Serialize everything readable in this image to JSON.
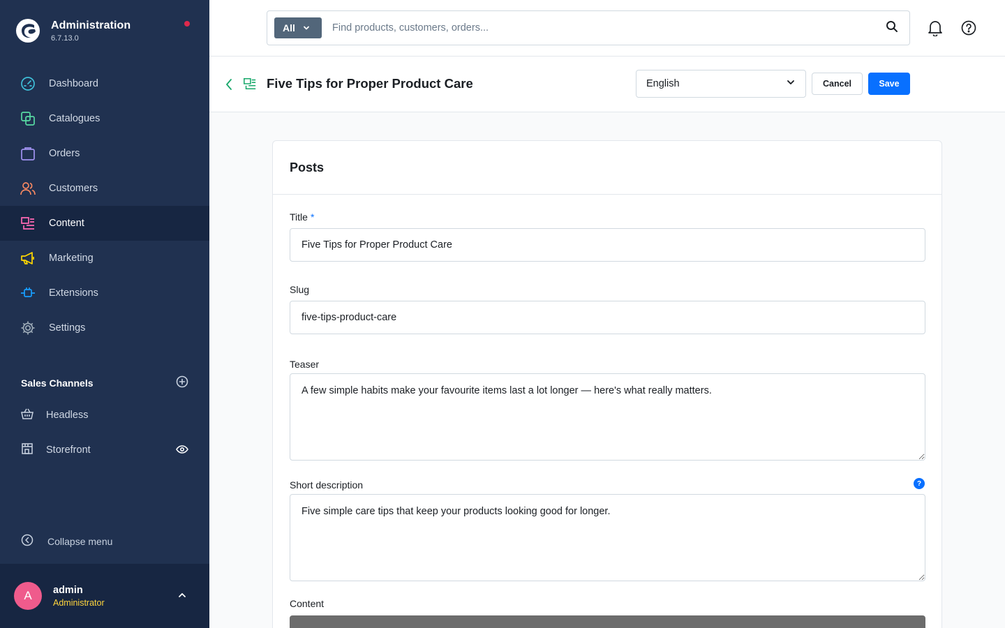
{
  "app": {
    "title": "Administration",
    "version": "6.7.13.0"
  },
  "sidebar": {
    "items": [
      {
        "label": "Dashboard",
        "icon": "dashboard-gauge-icon"
      },
      {
        "label": "Catalogues",
        "icon": "catalogue-icon"
      },
      {
        "label": "Orders",
        "icon": "shopping-bag-icon"
      },
      {
        "label": "Customers",
        "icon": "users-icon"
      },
      {
        "label": "Content",
        "icon": "content-icon",
        "active": true
      },
      {
        "label": "Marketing",
        "icon": "megaphone-icon"
      },
      {
        "label": "Extensions",
        "icon": "plug-icon"
      },
      {
        "label": "Settings",
        "icon": "gear-icon"
      }
    ],
    "sales_channels_title": "Sales Channels",
    "sales_channels": [
      {
        "label": "Headless",
        "icon": "basket-icon"
      },
      {
        "label": "Storefront",
        "icon": "storefront-icon"
      }
    ],
    "collapse_label": "Collapse menu",
    "user": {
      "initial": "A",
      "name": "admin",
      "role": "Administrator"
    }
  },
  "search": {
    "type_label": "All",
    "placeholder": "Find products, customers, orders..."
  },
  "smartbar": {
    "title": "Five Tips for Proper Product Care",
    "language": "English",
    "cancel_label": "Cancel",
    "save_label": "Save"
  },
  "card": {
    "title": "Posts",
    "fields": {
      "title_label": "Title",
      "title_required_mark": "*",
      "title_value": "Five Tips for Proper Product Care",
      "slug_label": "Slug",
      "slug_value": "five-tips-product-care",
      "teaser_label": "Teaser",
      "teaser_value": "A few simple habits make your favourite items last a lot longer — here's what really matters.",
      "short_description_label": "Short description",
      "short_description_help": "?",
      "short_description_value": "Five simple care tips that keep your products looking good for longer.",
      "content_label": "Content"
    }
  },
  "colors": {
    "sidebar_bg": "#203150",
    "sidebar_active_bg": "#172642",
    "primary": "#0870ff",
    "dashboard_icon": "#3fbfd8",
    "catalogue_icon": "#57d9a3",
    "orders_icon": "#a092f0",
    "customers_icon": "#f88962",
    "content_icon": "#ff68b4",
    "marketing_icon": "#ffd700",
    "extensions_icon": "#189eff",
    "settings_icon": "#9aa8b5",
    "avatar_bg": "#ef5b8c",
    "user_role": "#ffd53d",
    "notify_dot": "#de294c"
  }
}
